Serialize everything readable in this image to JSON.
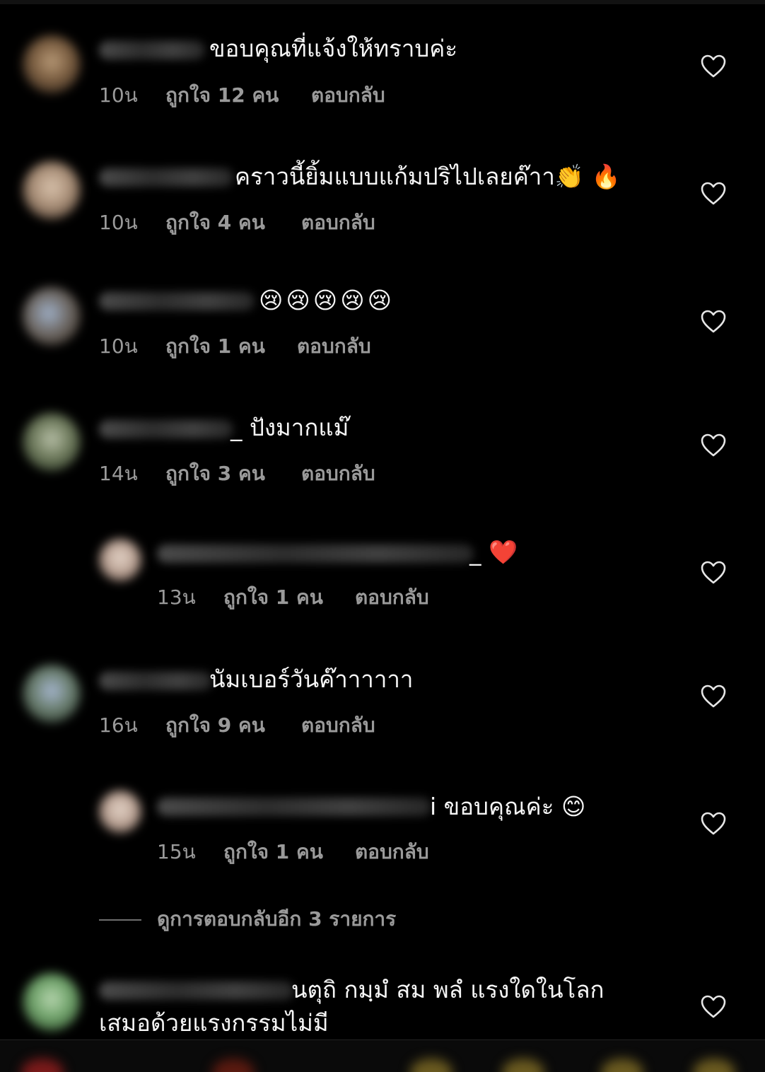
{
  "comments": [
    {
      "text": "ขอบคุณที่แจ้งให้ทราบค่ะ",
      "time": "10น",
      "likes": "ถูกใจ 12 คน",
      "reply": "ตอบกลับ"
    },
    {
      "text": "คราวนี้ยิ้มแบบแก้มปริไปเลยค๊าา👏 🔥",
      "time": "10น",
      "likes": "ถูกใจ 4 คน",
      "reply": "ตอบกลับ"
    },
    {
      "text": "😢😢😢😢😢",
      "time": "10น",
      "likes": "ถูกใจ 1 คน",
      "reply": "ตอบกลับ"
    },
    {
      "text": "_ ปังมากแม๊",
      "time": "14น",
      "likes": "ถูกใจ 3 คน",
      "reply": "ตอบกลับ"
    },
    {
      "text": "_ ❤️",
      "time": "13น",
      "likes": "ถูกใจ 1 คน",
      "reply": "ตอบกลับ"
    },
    {
      "text": "นัมเบอร์วันค๊าาาาาา",
      "time": "16น",
      "likes": "ถูกใจ 9 คน",
      "reply": "ตอบกลับ"
    },
    {
      "text": "i ขอบคุณค่ะ 😊",
      "time": "15น",
      "likes": "ถูกใจ 1 คน",
      "reply": "ตอบกลับ"
    },
    {
      "text_line1": "นตุถิ กมฺมํ สม พลํ แรงใดในโลก",
      "text_line2": "เสมอด้วยแรงกรรมไม่มี"
    }
  ],
  "view_more_replies": "ดูการตอบกลับอีก 3 รายการ",
  "icons": {
    "like": "heart-outline-icon"
  },
  "colors": {
    "background": "#000000",
    "text_primary": "#f5f5f5",
    "text_secondary": "#9a9a9a"
  }
}
